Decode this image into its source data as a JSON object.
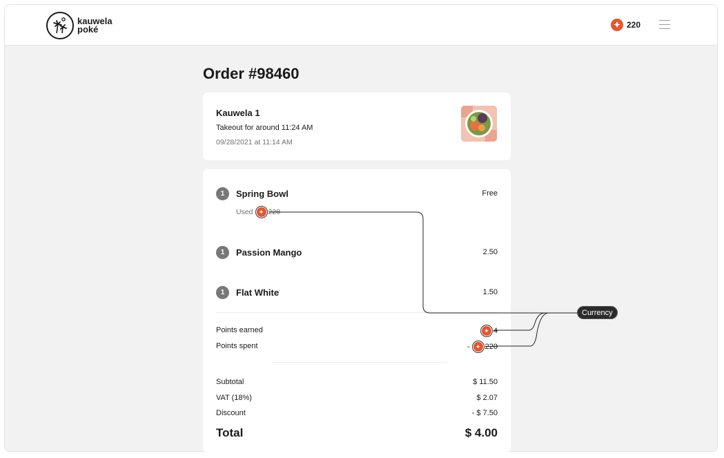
{
  "brand": {
    "line1": "kauwela",
    "line2": "poké"
  },
  "header": {
    "points": "220"
  },
  "order": {
    "title": "Order #98460",
    "store": "Kauwela 1",
    "takeout": "Takeout for around 11:24 AM",
    "placed": "09/28/2021 at 11:14 AM"
  },
  "items": [
    {
      "qty": "1",
      "name": "Spring Bowl",
      "price": "Free",
      "used_label": "Used",
      "used_amount": "220"
    },
    {
      "qty": "1",
      "name": "Passion Mango",
      "price": "2.50"
    },
    {
      "qty": "1",
      "name": "Flat White",
      "price": "1.50"
    }
  ],
  "points": {
    "earned_label": "Points earned",
    "earned_value": "4",
    "spent_label": "Points spent",
    "spent_prefix": "-",
    "spent_value": "220"
  },
  "summary": {
    "subtotal_label": "Subtotal",
    "subtotal_value": "$ 11.50",
    "vat_label": "VAT (18%)",
    "vat_value": "$ 2.07",
    "discount_label": "Discount",
    "discount_value": "- $ 7.50",
    "total_label": "Total",
    "total_value": "$ 4.00"
  },
  "annotation": {
    "label": "Currency"
  },
  "colors": {
    "accent": "#e8552e",
    "background": "#f2f2f2",
    "card": "#ffffff"
  },
  "icons": {
    "coin": "star-coin-icon",
    "menu": "hamburger-menu-icon",
    "logo": "palm-trees-logo"
  }
}
